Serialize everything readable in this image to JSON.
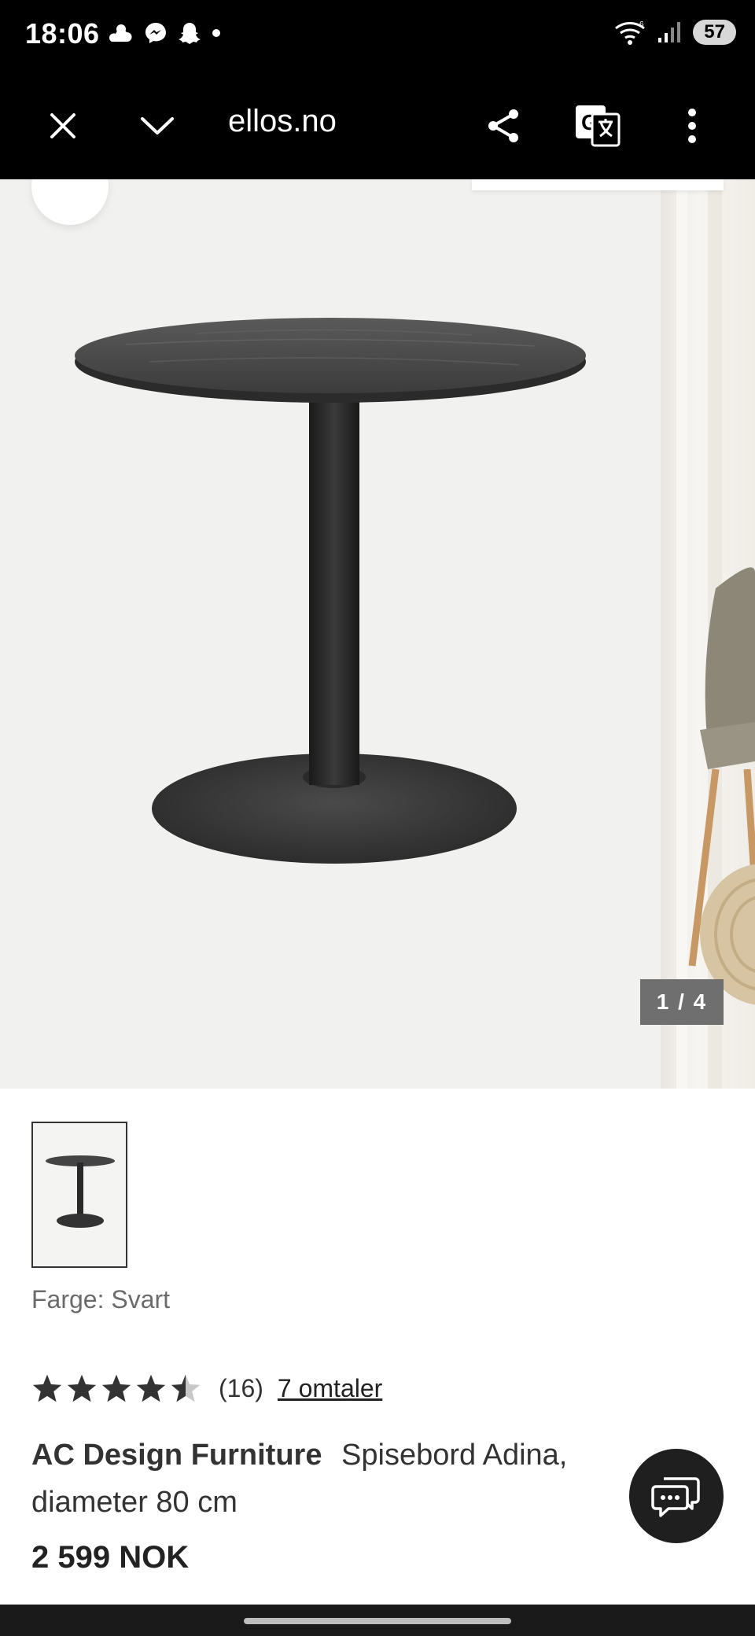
{
  "status_bar": {
    "time": "18:06",
    "battery": "57",
    "icons": [
      "weather-icon",
      "messenger-icon",
      "snapchat-icon",
      "dot-icon",
      "wifi-icon",
      "signal-icon",
      "battery-icon"
    ]
  },
  "browser": {
    "url": "ellos.no",
    "icons": [
      "close-icon",
      "chevron-down-icon",
      "share-icon",
      "translate-icon",
      "more-vert-icon"
    ]
  },
  "gallery": {
    "counter": "1 / 4"
  },
  "product": {
    "color_label": "Farge: Svart",
    "rating_value": 4.5,
    "rating_count": "(16)",
    "reviews_link": "7 omtaler",
    "brand": "AC Design Furniture",
    "name": "Spisebord Adina, diameter 80 cm",
    "price": "2 599 NOK"
  },
  "colors": {
    "browser_bg": "#000000",
    "counter_bg": "#6f6f6f",
    "fab_bg": "#1f1f1f"
  }
}
